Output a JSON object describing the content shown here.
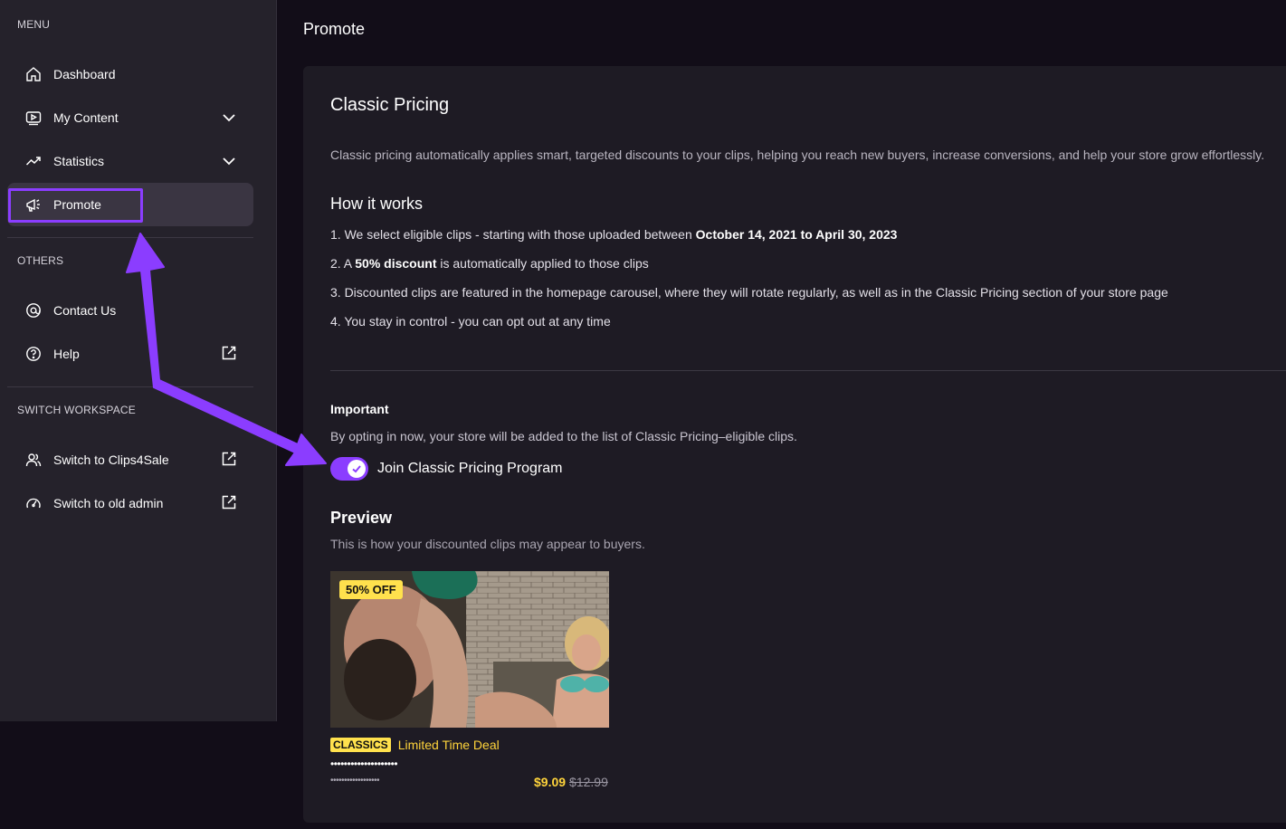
{
  "sidebar": {
    "menu_label": "MENU",
    "items": [
      {
        "label": "Dashboard",
        "icon": "home-icon"
      },
      {
        "label": "My Content",
        "icon": "video-icon"
      },
      {
        "label": "Statistics",
        "icon": "trend-icon"
      },
      {
        "label": "Promote",
        "icon": "megaphone-icon"
      }
    ],
    "others_label": "OTHERS",
    "others": [
      {
        "label": "Contact Us",
        "icon": "at-icon"
      },
      {
        "label": "Help",
        "icon": "help-icon"
      }
    ],
    "workspace_label": "SWITCH WORKSPACE",
    "workspace": [
      {
        "label": "Switch to Clips4Sale",
        "icon": "users-icon"
      },
      {
        "label": "Switch to old admin",
        "icon": "gauge-icon"
      }
    ]
  },
  "page": {
    "title": "Promote"
  },
  "card": {
    "title": "Classic Pricing",
    "description": "Classic pricing automatically applies smart, targeted discounts to your clips, helping you reach new buyers, increase conversions, and help your store grow effortlessly.",
    "how_title": "How it works",
    "steps": [
      {
        "pre": "1.  We select eligible clips - starting with those uploaded between ",
        "bold": "October 14, 2021 to April 30, 2023",
        "post": ""
      },
      {
        "pre": "2.  A ",
        "bold": "50% discount",
        "post": " is automatically applied to those clips"
      },
      {
        "pre": "3.  Discounted clips are featured in the homepage carousel, where they will rotate regularly, as well as in the Classic Pricing section of your store page",
        "bold": "",
        "post": ""
      },
      {
        "pre": "4.  You stay in control - you can opt out at any time",
        "bold": "",
        "post": ""
      }
    ],
    "important_title": "Important",
    "important_text": "By opting in now, your store will be added to the list of Classic Pricing–eligible clips.",
    "toggle_label": "Join Classic Pricing Program",
    "toggle_on": true,
    "preview_title": "Preview",
    "preview_sub": "This is how your discounted clips may appear to buyers.",
    "clip": {
      "badge": "50% OFF",
      "tag": "CLASSICS",
      "deal": "Limited Time Deal",
      "title_mask": "••••••••••••••••••••",
      "studio_mask": "••••••••••••••••••",
      "price": "$9.09",
      "orig_price": "$12.99"
    }
  },
  "colors": {
    "accent": "#8b3dff",
    "sale": "#ffe14d",
    "sidebar_bg": "#25222b",
    "card_bg": "#1e1b24"
  }
}
